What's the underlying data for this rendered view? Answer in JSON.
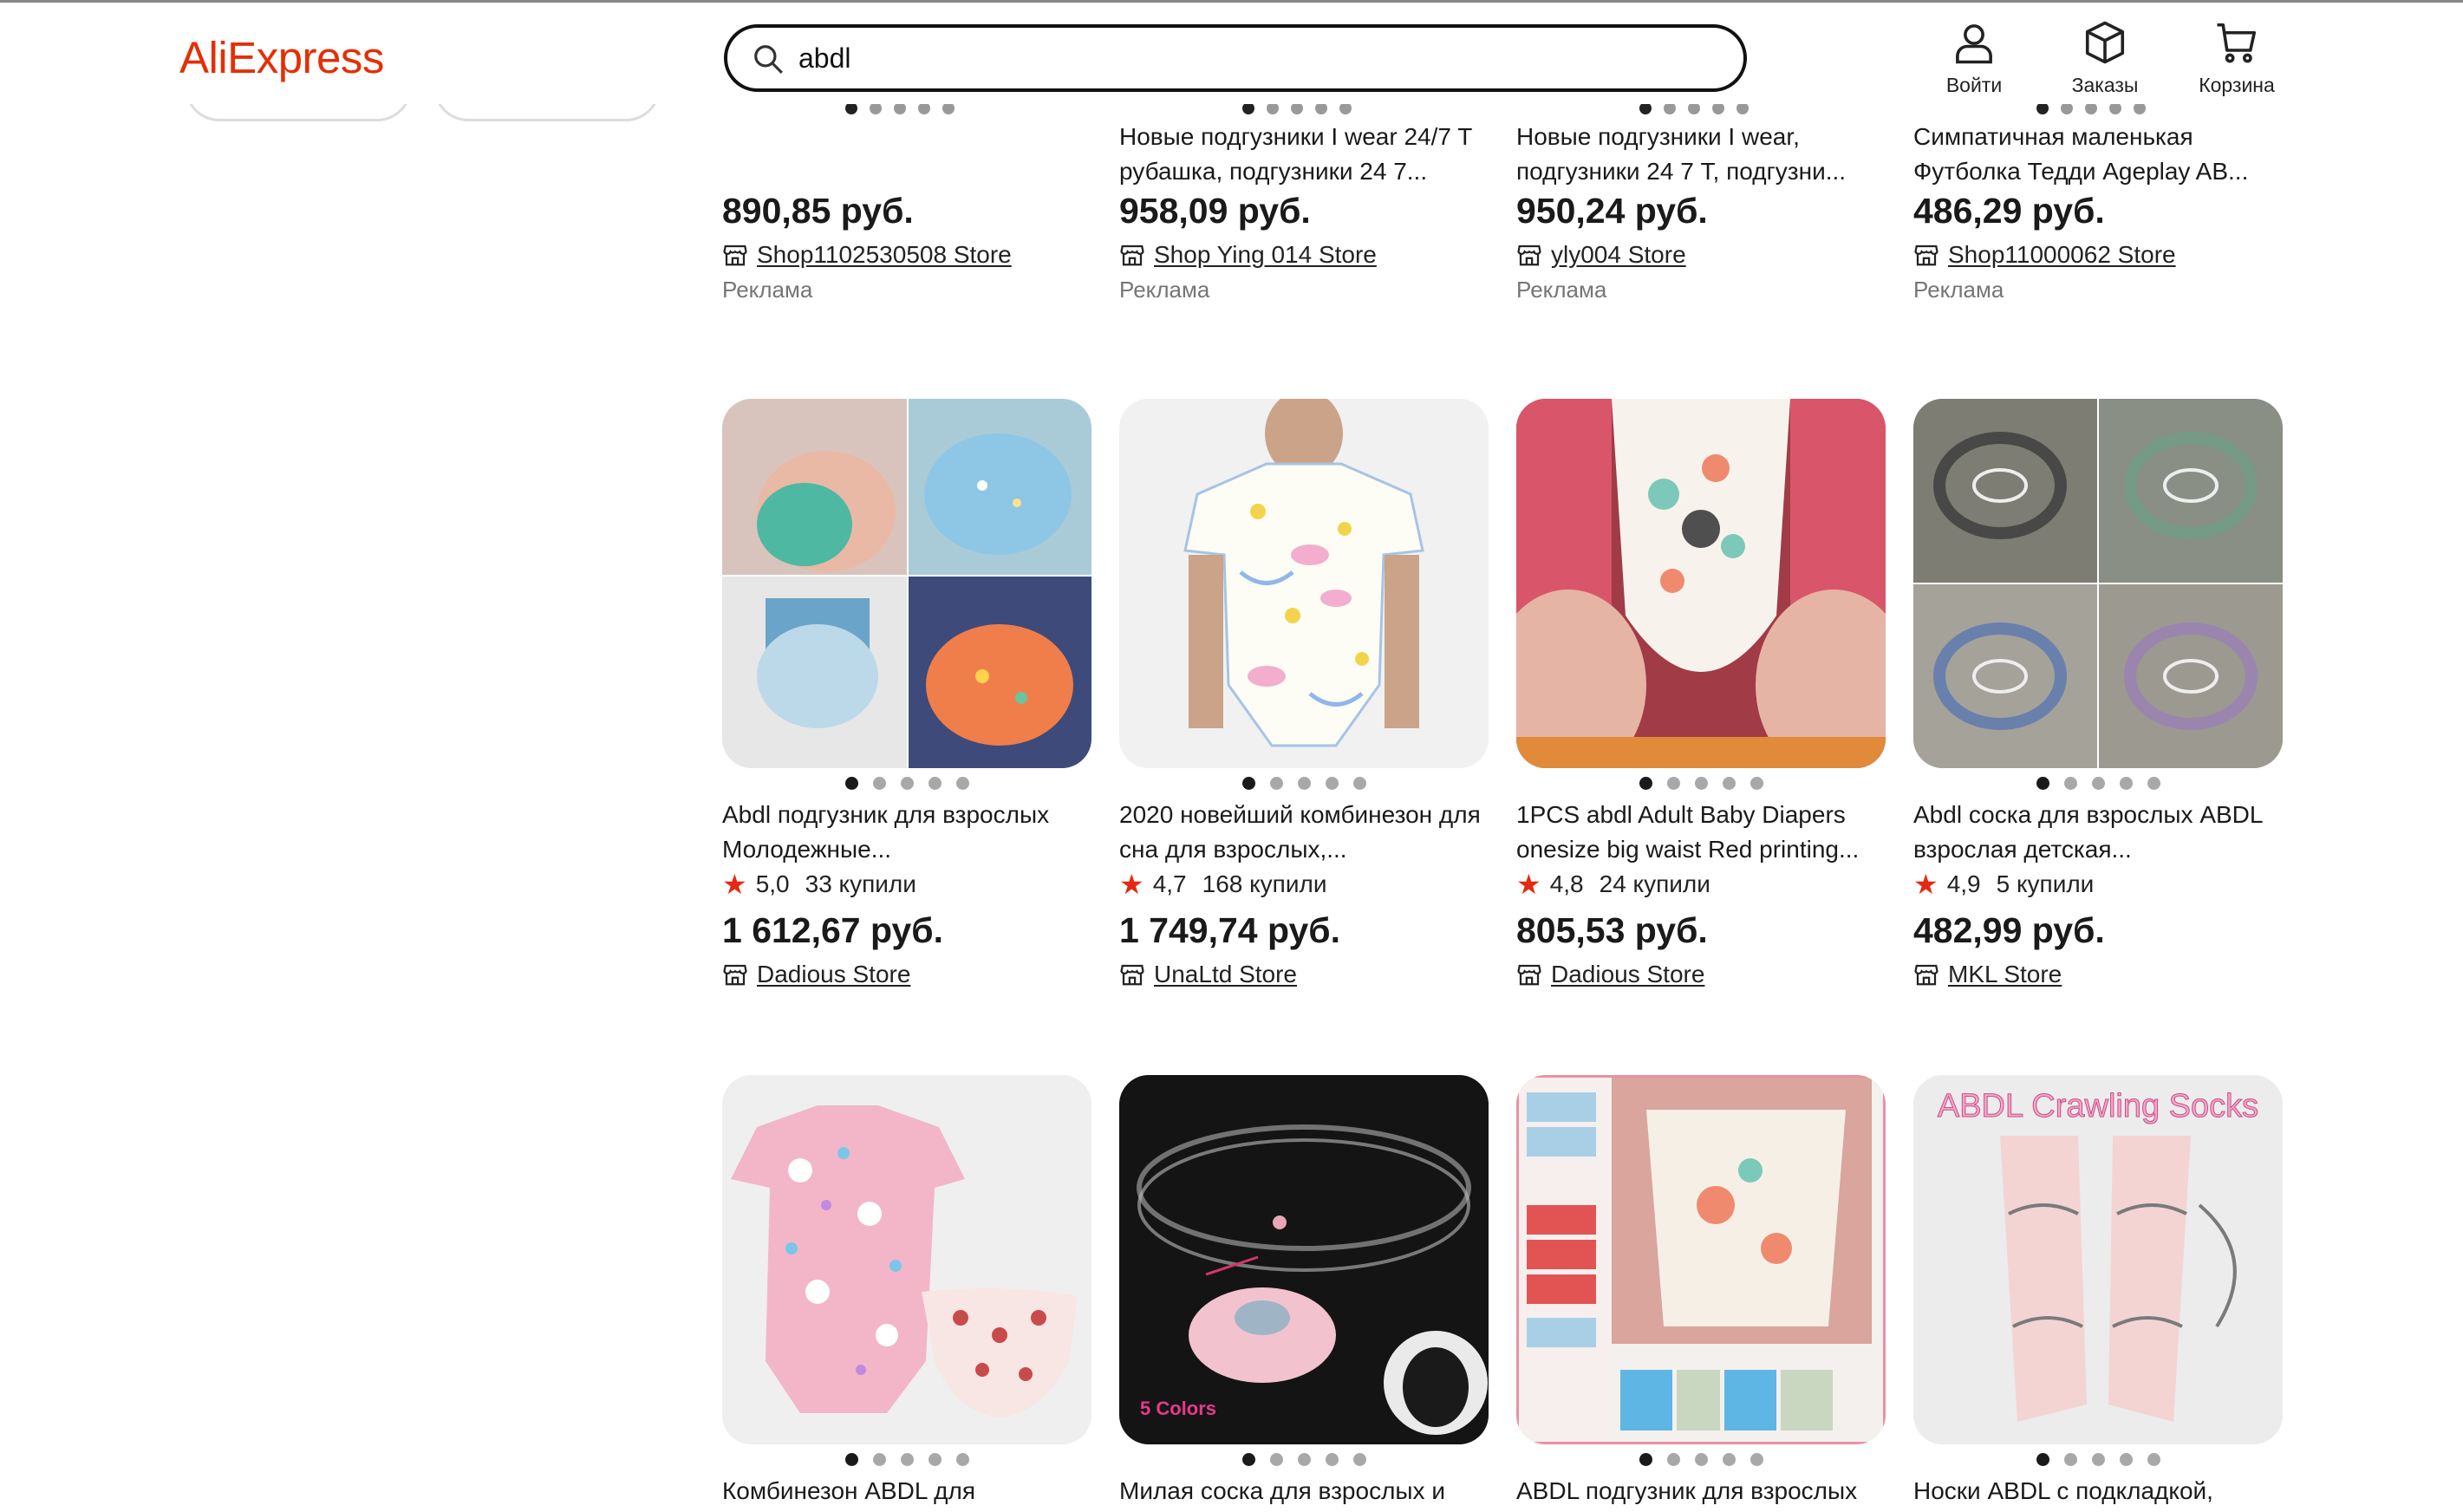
{
  "header": {
    "logo": "AliExpress",
    "search_value": "abdl",
    "nav": [
      {
        "label": "Войти",
        "icon": "user-icon"
      },
      {
        "label": "Заказы",
        "icon": "box-icon"
      },
      {
        "label": "Корзина",
        "icon": "cart-icon"
      }
    ]
  },
  "colors": {
    "brand": "#e62e04",
    "star": "#e42a12",
    "text": "#1a1a1a",
    "muted": "#757575"
  },
  "top_row": [
    {
      "title": "",
      "price": "890,85 руб.",
      "store": "Shop1102530508 Store",
      "ad": "Реклама"
    },
    {
      "title": "Новые подгузники I wear 24/7 T рубашка, подгузники 24 7...",
      "price": "958,09 руб.",
      "store": "Shop Ying 014 Store",
      "ad": "Реклама"
    },
    {
      "title": "Новые подгузники I wear, подгузники 24 7 T, подгузни...",
      "price": "950,24 руб.",
      "store": "yly004 Store",
      "ad": "Реклама"
    },
    {
      "title": "Симпатичная маленькая Футболка Тедди Ageplay AB...",
      "price": "486,29 руб.",
      "store": "Shop11000062 Store",
      "ad": "Реклама"
    }
  ],
  "middle_row": [
    {
      "title": "Abdl подгузник для взрослых Молодежные...",
      "rating": "5,0",
      "buys": "33 купили",
      "price": "1 612,67 руб.",
      "store": "Dadious Store"
    },
    {
      "title": "2020 новейший комбинезон для сна для взрослых,...",
      "rating": "4,7",
      "buys": "168 купили",
      "price": "1 749,74 руб.",
      "store": "UnaLtd Store"
    },
    {
      "title": "1PCS abdl Adult Baby Diapers onesize big waist Red printing...",
      "rating": "4,8",
      "buys": "24 купили",
      "price": "805,53 руб.",
      "store": "Dadious Store"
    },
    {
      "title": "Abdl соска для взрослых ABDL взрослая детская...",
      "rating": "4,9",
      "buys": "5 купили",
      "price": "482,99 руб.",
      "store": "MKL Store"
    }
  ],
  "bottom_row": [
    {
      "title": "Комбинезон ABDL для"
    },
    {
      "title": "Милая соска для взрослых и",
      "image_text": "5 Colors"
    },
    {
      "title": "ABDL подгузник для взрослых"
    },
    {
      "title": "Носки ABDL с подкладкой,",
      "image_text": "ABDL Crawling Socks"
    }
  ]
}
